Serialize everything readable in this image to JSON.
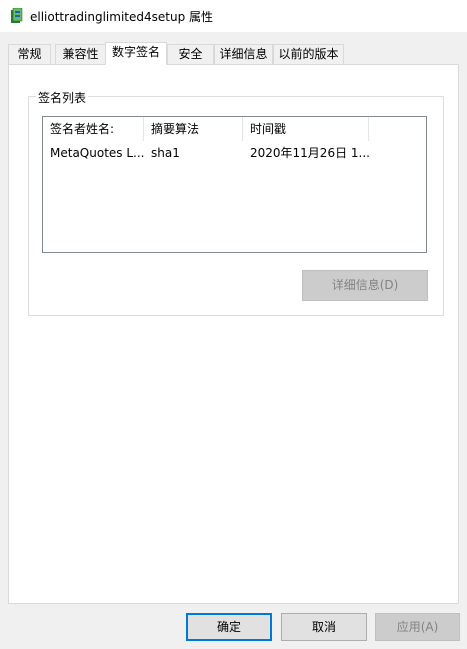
{
  "window": {
    "title": "elliottradinglimited4setup 属性",
    "icon": "setup-installer-icon"
  },
  "tabs": [
    {
      "label": "常规",
      "active": false
    },
    {
      "label": "兼容性",
      "active": false
    },
    {
      "label": "数字签名",
      "active": true
    },
    {
      "label": "安全",
      "active": false
    },
    {
      "label": "详细信息",
      "active": false
    },
    {
      "label": "以前的版本",
      "active": false
    }
  ],
  "signature_group": {
    "legend": "签名列表",
    "columns": [
      "签名者姓名:",
      "摘要算法",
      "时间戳"
    ],
    "rows": [
      [
        "MetaQuotes L...",
        "sha1",
        "2020年11月26日 1..."
      ]
    ],
    "details_button": "详细信息(D)",
    "details_enabled": false
  },
  "buttons": {
    "ok": "确定",
    "cancel": "取消",
    "apply": "应用(A)",
    "apply_enabled": false
  },
  "colors": {
    "accent": "#0078d7",
    "window_bg": "#f0f0f0",
    "panel_bg": "#ffffff",
    "disabled_text": "#838383"
  }
}
